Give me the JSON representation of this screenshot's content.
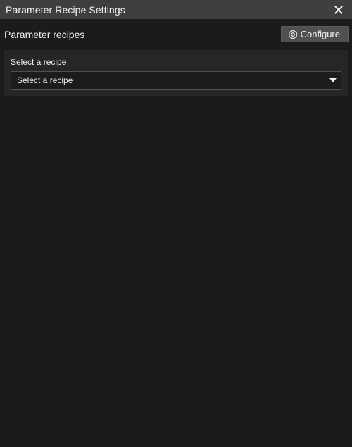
{
  "window": {
    "title": "Parameter Recipe Settings"
  },
  "header": {
    "section_title": "Parameter recipes",
    "configure_label": "Configure",
    "configure_icon": "hexagon-gear-icon"
  },
  "recipe_select": {
    "label": "Select a recipe",
    "value": "Select a recipe",
    "icon": "caret-down-icon"
  },
  "colors": {
    "titlebar_bg": "#3f3f3f",
    "window_bg": "#1b1b1b",
    "panel_bg": "#262626",
    "button_bg": "#505050",
    "text": "#f0f0f0"
  }
}
